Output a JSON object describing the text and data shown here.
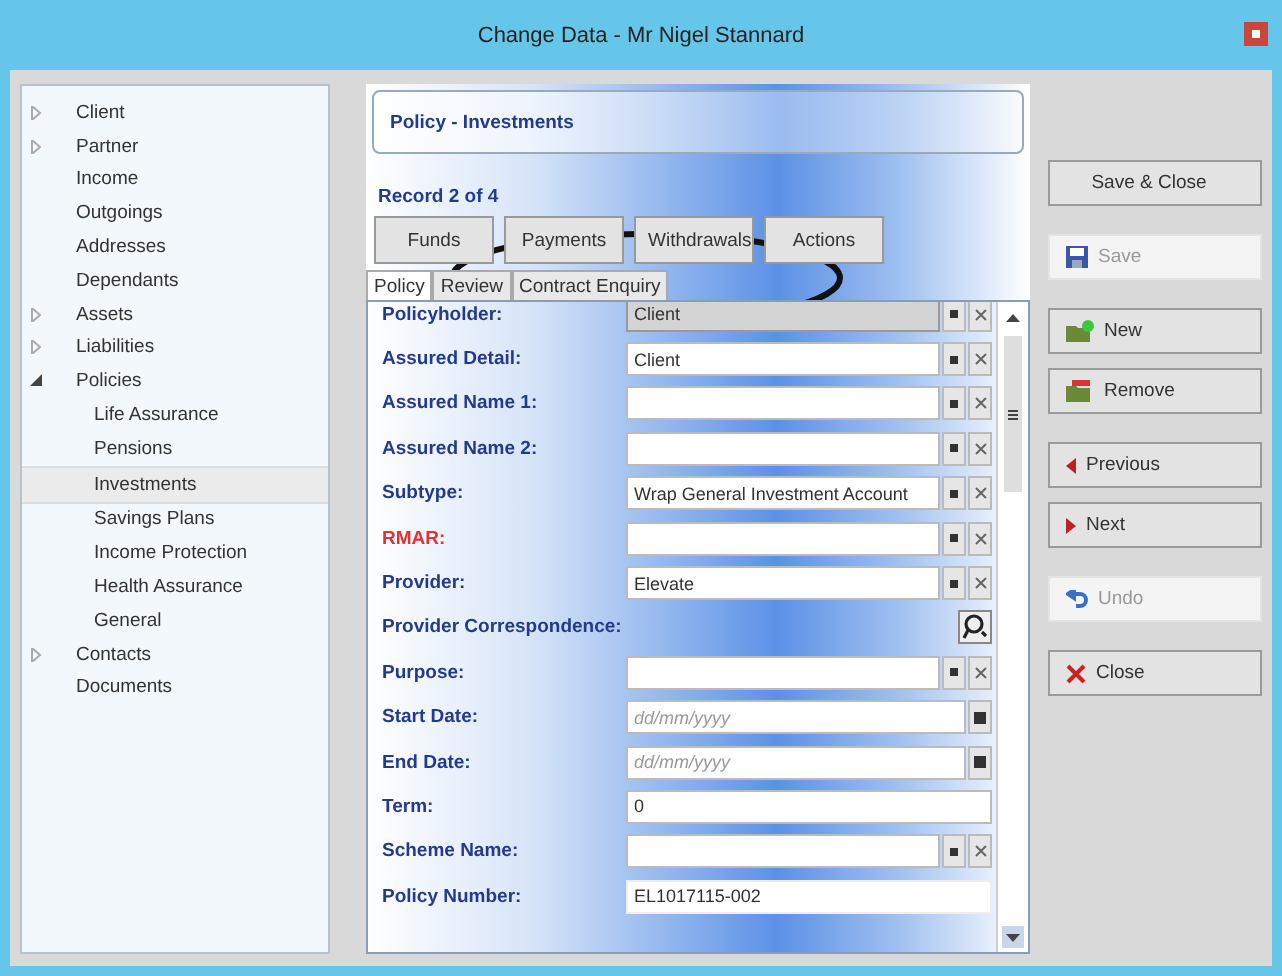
{
  "window": {
    "title": "Change Data - Mr Nigel Stannard"
  },
  "sidebar": {
    "items": [
      {
        "label": "Client",
        "expandable": true,
        "expanded": false,
        "selected": false
      },
      {
        "label": "Partner",
        "expandable": true,
        "expanded": false,
        "selected": false
      },
      {
        "label": "Income",
        "expandable": false,
        "expanded": false,
        "selected": false
      },
      {
        "label": "Outgoings",
        "expandable": false,
        "expanded": false,
        "selected": false
      },
      {
        "label": "Addresses",
        "expandable": false,
        "expanded": false,
        "selected": false
      },
      {
        "label": "Dependants",
        "expandable": false,
        "expanded": false,
        "selected": false
      },
      {
        "label": "Assets",
        "expandable": true,
        "expanded": false,
        "selected": false
      },
      {
        "label": "Liabilities",
        "expandable": true,
        "expanded": false,
        "selected": false
      },
      {
        "label": "Policies",
        "expandable": true,
        "expanded": true,
        "selected": false,
        "children": [
          {
            "label": "Life Assurance",
            "selected": false
          },
          {
            "label": "Pensions",
            "selected": false
          },
          {
            "label": "Investments",
            "selected": true
          },
          {
            "label": "Savings Plans",
            "selected": false
          },
          {
            "label": "Income Protection",
            "selected": false
          },
          {
            "label": "Health Assurance",
            "selected": false
          },
          {
            "label": "General",
            "selected": false
          }
        ]
      },
      {
        "label": "Contacts",
        "expandable": true,
        "expanded": false,
        "selected": false
      },
      {
        "label": "Documents",
        "expandable": false,
        "expanded": false,
        "selected": false
      }
    ]
  },
  "panel": {
    "title": "Policy - Investments",
    "record": "Record 2 of 4",
    "buttons": [
      "Funds",
      "Payments",
      "Withdrawals",
      "Actions"
    ],
    "tabs": [
      {
        "label": "Policy",
        "selected": true
      },
      {
        "label": "Review",
        "selected": false
      },
      {
        "label": "Contract Enquiry",
        "selected": false
      }
    ],
    "fields": [
      {
        "label": "Policyholder:",
        "kind": "combo",
        "value": "Client",
        "mandatory": false,
        "disabled": true
      },
      {
        "label": "Assured Detail:",
        "kind": "combo",
        "value": "Client",
        "mandatory": false,
        "disabled": false
      },
      {
        "label": "Assured Name 1:",
        "kind": "combo",
        "mandatory": false,
        "disabled": false
      },
      {
        "label": "Assured Name 2:",
        "kind": "combo",
        "mandatory": false,
        "disabled": false
      },
      {
        "label": "Subtype:",
        "kind": "combo",
        "value": "Wrap General Investment Account",
        "mandatory": false,
        "disabled": false
      },
      {
        "label": "RMAR:",
        "kind": "combo",
        "mandatory": true,
        "disabled": false
      },
      {
        "label": "Provider:",
        "kind": "combo",
        "value": "Elevate",
        "mandatory": false,
        "disabled": false
      },
      {
        "label": "Provider Correspondence:",
        "kind": "lookup",
        "mandatory": false,
        "disabled": false
      },
      {
        "label": "Purpose:",
        "kind": "combo",
        "mandatory": false,
        "disabled": false
      },
      {
        "label": "Start Date:",
        "kind": "date",
        "placeholder": "dd/mm/yyyy",
        "mandatory": false,
        "disabled": false
      },
      {
        "label": "End Date:",
        "kind": "date",
        "placeholder": "dd/mm/yyyy",
        "mandatory": false,
        "disabled": false
      },
      {
        "label": "Term:",
        "kind": "text",
        "value": "0",
        "mandatory": false,
        "disabled": false
      },
      {
        "label": "Scheme Name:",
        "kind": "combo",
        "mandatory": false,
        "disabled": false
      },
      {
        "label": "Policy Number:",
        "kind": "readonly",
        "value": "EL1017115-002",
        "mandatory": false,
        "disabled": false
      }
    ]
  },
  "actions": [
    {
      "label": "Save & Close",
      "kind": "plain",
      "disabled": false
    },
    {
      "label": "Save",
      "kind": "save",
      "disabled": true
    },
    {
      "label": "New",
      "kind": "new",
      "disabled": false
    },
    {
      "label": "Remove",
      "kind": "remove",
      "disabled": false
    },
    {
      "label": "Previous",
      "kind": "previous",
      "disabled": false
    },
    {
      "label": "Next",
      "kind": "next",
      "disabled": false
    },
    {
      "label": "Undo",
      "kind": "undo",
      "disabled": true
    },
    {
      "label": "Close",
      "kind": "close",
      "disabled": false
    }
  ]
}
